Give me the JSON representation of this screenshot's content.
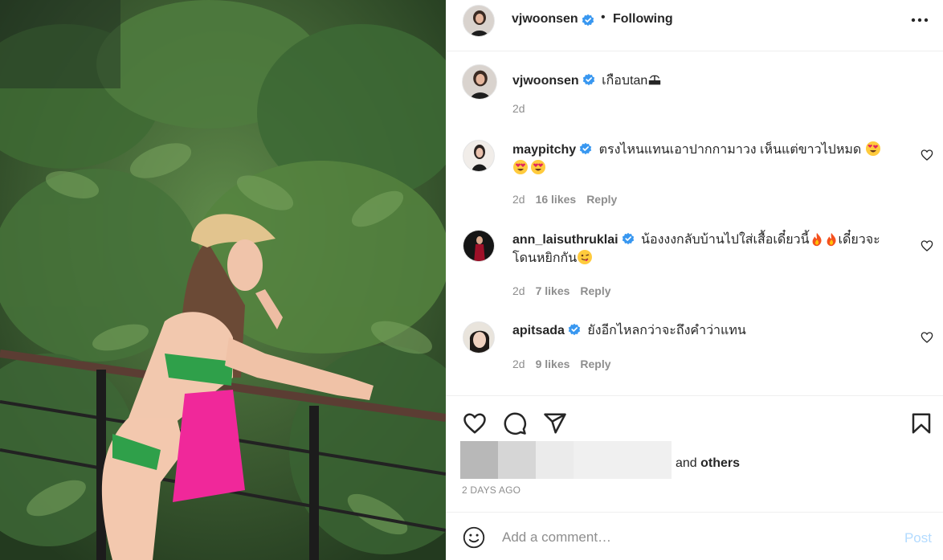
{
  "header": {
    "username": "vjwoonsen",
    "separator": "•",
    "follow_status": "Following",
    "more_icon": "more-horizontal-icon"
  },
  "caption": {
    "username": "vjwoonsen",
    "text": "เกือบtan",
    "time": "2d"
  },
  "comments": [
    {
      "username": "maypitchy",
      "text_line1": "ตรงไหนแทนเอาปากกามาวง เห็นแต่ขาวไปหมด",
      "time": "2d",
      "likes": "16 likes",
      "reply": "Reply"
    },
    {
      "username": "ann_laisuthruklai",
      "text_line1": "น้องงงกลับบ้านไปใส่เสื้อเดี๋ยวนี้",
      "text_line1b": "เดี๋ยวจะ",
      "text_line2": "โดนหยิกกัน",
      "time": "2d",
      "likes": "7 likes",
      "reply": "Reply"
    },
    {
      "username": "apitsada",
      "text_line1": "ยังอีกไหลกว่าจะถึงคำว่าแทน",
      "time": "2d",
      "likes": "9 likes",
      "reply": "Reply"
    }
  ],
  "actions": {
    "and_text": "and",
    "others_text": "others",
    "posted": "2 DAYS AGO"
  },
  "add_comment": {
    "placeholder": "Add a comment…",
    "post_label": "Post"
  },
  "colors": {
    "verified": "#3897f0",
    "post_disabled": "#b3dbff",
    "muted": "#8e8e8e"
  }
}
